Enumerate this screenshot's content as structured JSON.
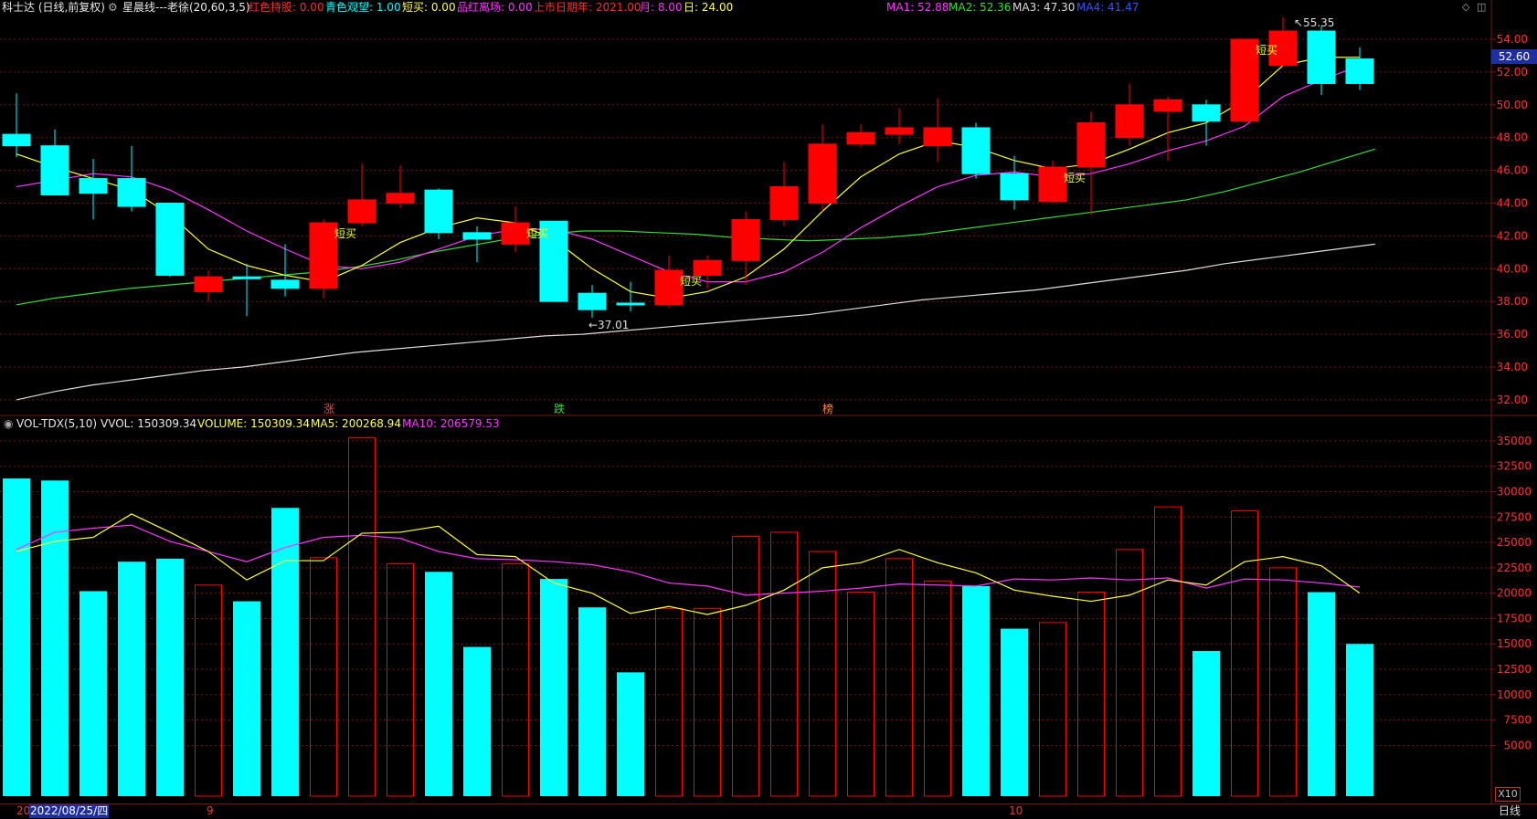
{
  "header": {
    "stock_label": "科士达 (日线,前复权)",
    "indicator_name": "星晨线---老徐(20,60,3,5)",
    "params": [
      {
        "text": "红色持股: 0.00",
        "color": "#ff2a2a"
      },
      {
        "text": "青色观望: 1.00",
        "color": "#00ffff"
      },
      {
        "text": "短买: 0.00",
        "color": "#ffff55"
      },
      {
        "text": "品红离场: 0.00",
        "color": "#ff33ff"
      },
      {
        "text": "上市日期年: 2021.00",
        "color": "#ff2a2a"
      },
      {
        "text": "月: 8.00",
        "color": "#ff33ff"
      },
      {
        "text": "日: 24.00",
        "color": "#ffff55"
      }
    ],
    "ma_readout": [
      {
        "text": "MA1: 52.88",
        "color": "#ff33ff"
      },
      {
        "text": "MA2: 52.36",
        "color": "#33dd33"
      },
      {
        "text": "MA3: 47.30",
        "color": "#dddddd"
      },
      {
        "text": "MA4: 41.47",
        "color": "#3355ff"
      }
    ]
  },
  "volume_header": {
    "name": "VOL-TDX(5,10)",
    "vvol": "VVOL: 150309.34",
    "volume": "VOLUME: 150309.34",
    "ma5": "MA5: 200268.94",
    "ma10": "MA10: 206579.53"
  },
  "price_axis": [
    "54.00",
    "52.00",
    "50.00",
    "48.00",
    "46.00",
    "44.00",
    "42.00",
    "40.00",
    "38.00",
    "36.00",
    "34.00",
    "32.00"
  ],
  "volume_axis": [
    "35000",
    "32500",
    "30000",
    "27500",
    "25000",
    "22500",
    "20000",
    "17500",
    "15000",
    "12500",
    "10000",
    "7500",
    "5000"
  ],
  "current_price": "52.60",
  "x10_label": "X10",
  "bottom": {
    "date": "2022/08/25/四",
    "prefix": "20",
    "month_9": "9",
    "month_10": "10",
    "period": "日线"
  },
  "annotations": {
    "high": "55.35",
    "low": "37.01",
    "short_buy": "短买",
    "markers": [
      "涨",
      "跌",
      "榜"
    ]
  },
  "colors": {
    "up": "#ff0000",
    "down": "#00ffff",
    "short_buy": "#e6ff33",
    "exit": "#ff99ff",
    "ma1": "#ff33ff",
    "ma2": "#33dd33",
    "ma3": "#dddddd",
    "ma4": "#3355ff",
    "grid": "#7a1414"
  },
  "chart_data": {
    "type": "candlestick",
    "ohlc": [
      {
        "o": 47.5,
        "h": 50.7,
        "l": 46.8,
        "c": 48.2,
        "style": "down"
      },
      {
        "o": 47.5,
        "h": 48.5,
        "l": 44.5,
        "c": 44.5,
        "style": "down"
      },
      {
        "o": 45.5,
        "h": 46.7,
        "l": 43.0,
        "c": 44.6,
        "style": "down"
      },
      {
        "o": 45.5,
        "h": 47.5,
        "l": 43.5,
        "c": 43.8,
        "style": "down"
      },
      {
        "o": 44.0,
        "h": 44.0,
        "l": 39.5,
        "c": 39.6,
        "style": "down"
      },
      {
        "o": 38.6,
        "h": 39.9,
        "l": 38.0,
        "c": 39.5,
        "style": "up"
      },
      {
        "o": 39.5,
        "h": 40.3,
        "l": 37.1,
        "c": 39.4,
        "style": "down"
      },
      {
        "o": 39.3,
        "h": 41.5,
        "l": 38.3,
        "c": 38.8,
        "style": "down"
      },
      {
        "o": 38.8,
        "h": 43.0,
        "l": 38.2,
        "c": 42.8,
        "style": "up"
      },
      {
        "o": 42.8,
        "h": 46.4,
        "l": 42.6,
        "c": 44.2,
        "style": "up"
      },
      {
        "o": 44.0,
        "h": 46.3,
        "l": 43.7,
        "c": 44.6,
        "style": "up"
      },
      {
        "o": 44.8,
        "h": 44.9,
        "l": 41.8,
        "c": 42.2,
        "style": "down"
      },
      {
        "o": 42.2,
        "h": 42.6,
        "l": 40.4,
        "c": 41.8,
        "style": "down"
      },
      {
        "o": 41.5,
        "h": 43.8,
        "l": 41.0,
        "c": 42.8,
        "style": "up"
      },
      {
        "o": 42.9,
        "h": 42.9,
        "l": 38.0,
        "c": 38.0,
        "style": "down"
      },
      {
        "o": 38.5,
        "h": 39.0,
        "l": 37.0,
        "c": 37.5,
        "style": "down"
      },
      {
        "o": 37.8,
        "h": 39.2,
        "l": 37.4,
        "c": 37.9,
        "style": "down"
      },
      {
        "o": 37.8,
        "h": 40.8,
        "l": 37.6,
        "c": 39.9,
        "style": "up"
      },
      {
        "o": 39.6,
        "h": 40.8,
        "l": 38.8,
        "c": 40.5,
        "style": "up"
      },
      {
        "o": 40.5,
        "h": 43.5,
        "l": 39.0,
        "c": 43.0,
        "style": "up"
      },
      {
        "o": 43.0,
        "h": 46.5,
        "l": 42.6,
        "c": 45.0,
        "style": "up"
      },
      {
        "o": 44.0,
        "h": 48.8,
        "l": 43.5,
        "c": 47.6,
        "style": "up"
      },
      {
        "o": 47.6,
        "h": 48.8,
        "l": 47.4,
        "c": 48.3,
        "style": "up"
      },
      {
        "o": 48.2,
        "h": 49.8,
        "l": 47.6,
        "c": 48.6,
        "style": "up"
      },
      {
        "o": 47.5,
        "h": 50.4,
        "l": 46.5,
        "c": 48.6,
        "style": "up"
      },
      {
        "o": 48.6,
        "h": 48.9,
        "l": 45.5,
        "c": 45.8,
        "style": "down"
      },
      {
        "o": 45.8,
        "h": 46.9,
        "l": 43.6,
        "c": 44.2,
        "style": "down"
      },
      {
        "o": 44.1,
        "h": 46.6,
        "l": 44.0,
        "c": 46.2,
        "style": "up"
      },
      {
        "o": 46.2,
        "h": 49.6,
        "l": 43.3,
        "c": 48.9,
        "style": "up"
      },
      {
        "o": 48.0,
        "h": 51.3,
        "l": 47.5,
        "c": 50.0,
        "style": "up"
      },
      {
        "o": 50.3,
        "h": 50.5,
        "l": 46.6,
        "c": 49.6,
        "style": "up"
      },
      {
        "o": 50.0,
        "h": 50.3,
        "l": 47.5,
        "c": 49.0,
        "style": "down"
      },
      {
        "o": 49.0,
        "h": 54.0,
        "l": 48.9,
        "c": 54.0,
        "style": "up"
      },
      {
        "o": 52.4,
        "h": 55.35,
        "l": 52.3,
        "c": 54.5,
        "style": "up"
      },
      {
        "o": 54.5,
        "h": 54.8,
        "l": 50.6,
        "c": 51.3,
        "style": "down"
      },
      {
        "o": 52.8,
        "h": 53.5,
        "l": 50.9,
        "c": 51.3,
        "style": "down"
      }
    ],
    "volume": [
      31300,
      31100,
      20200,
      23100,
      23400,
      20800,
      19200,
      28400,
      23500,
      35300,
      22900,
      22100,
      14700,
      22900,
      21400,
      18600,
      12200,
      18500,
      18500,
      25600,
      26000,
      24100,
      20100,
      23400,
      21200,
      20700,
      16500,
      17100,
      20100,
      24300,
      28500,
      14300,
      28100,
      22500,
      20100,
      15000
    ],
    "volume_ma5": [
      24100,
      25100,
      25500,
      27800,
      26000,
      24100,
      21300,
      23200,
      23200,
      25900,
      26000,
      26600,
      23800,
      23600,
      21000,
      20000,
      18000,
      18700,
      17900,
      18800,
      20300,
      22500,
      23000,
      24300,
      23000,
      22000,
      20300,
      19700,
      19200,
      19800,
      21300,
      20800,
      23100,
      23600,
      22700,
      20000
    ],
    "volume_ma10": [
      24300,
      26000,
      26400,
      26700,
      25100,
      24100,
      23100,
      24500,
      25500,
      25700,
      25400,
      24100,
      23400,
      23300,
      23100,
      22800,
      22100,
      21000,
      20700,
      19800,
      20000,
      20200,
      20500,
      20900,
      20800,
      20700,
      21400,
      21300,
      21500,
      21300,
      21500,
      20500,
      21400,
      21300,
      21000,
      20600
    ],
    "ma1": [
      47.0,
      46.2,
      45.5,
      44.8,
      43.3,
      41.2,
      40.2,
      39.6,
      39.2,
      40.2,
      41.6,
      42.5,
      43.1,
      42.8,
      41.8,
      40.0,
      38.6,
      38.2,
      38.6,
      39.5,
      41.2,
      43.5,
      45.6,
      47.0,
      47.8,
      47.4,
      46.6,
      46.1,
      46.4,
      47.3,
      48.3,
      48.9,
      50.3,
      52.4,
      52.9,
      52.9
    ],
    "ma2": [
      45.0,
      45.4,
      45.8,
      45.6,
      44.8,
      43.6,
      42.3,
      41.2,
      40.2,
      40.0,
      40.4,
      41.2,
      42.0,
      42.4,
      42.4,
      41.8,
      40.8,
      39.8,
      39.2,
      39.2,
      39.8,
      41.0,
      42.5,
      43.8,
      45.0,
      45.7,
      45.9,
      45.6,
      45.8,
      46.4,
      47.2,
      47.8,
      48.7,
      50.5,
      51.5,
      52.4
    ],
    "ma3": [
      37.8,
      38.2,
      38.5,
      38.8,
      39.0,
      39.2,
      39.4,
      39.6,
      39.8,
      40.1,
      40.5,
      41.0,
      41.4,
      41.8,
      42.1,
      42.3,
      42.3,
      42.2,
      42.1,
      41.9,
      41.8,
      41.7,
      41.8,
      41.9,
      42.1,
      42.4,
      42.7,
      43.0,
      43.3,
      43.6,
      43.9,
      44.2,
      44.7,
      45.3,
      45.9,
      46.6,
      47.3
    ],
    "ma4": [
      32.0,
      32.5,
      32.9,
      33.2,
      33.5,
      33.8,
      34.0,
      34.3,
      34.6,
      34.9,
      35.1,
      35.3,
      35.5,
      35.7,
      35.9,
      36.0,
      36.2,
      36.4,
      36.6,
      36.8,
      37.0,
      37.2,
      37.5,
      37.8,
      38.1,
      38.3,
      38.5,
      38.7,
      39.0,
      39.3,
      39.6,
      39.9,
      40.3,
      40.6,
      40.9,
      41.2,
      41.5
    ]
  }
}
